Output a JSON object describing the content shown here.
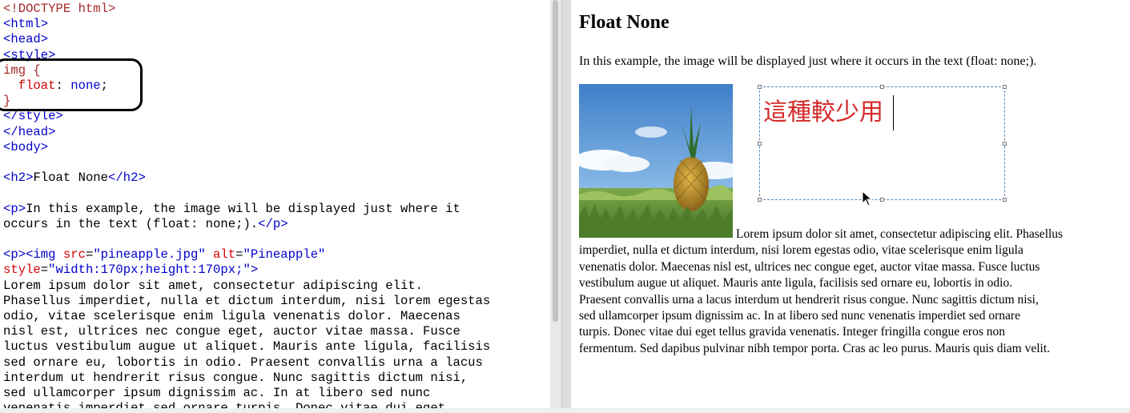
{
  "editor": {
    "lines": [
      [
        {
          "c": "t",
          "s": "<!DOCTYPE html>"
        }
      ],
      [
        {
          "c": "tg",
          "s": "<html>"
        }
      ],
      [
        {
          "c": "tg",
          "s": "<head>"
        }
      ],
      [
        {
          "c": "tg",
          "s": "<style>"
        }
      ],
      [
        {
          "c": "sel",
          "s": "img {"
        }
      ],
      [
        {
          "c": "",
          "s": "  "
        },
        {
          "c": "pr",
          "s": "float"
        },
        {
          "c": "",
          "s": ": "
        },
        {
          "c": "pv",
          "s": "none"
        },
        {
          "c": "",
          "s": ";"
        }
      ],
      [
        {
          "c": "sel",
          "s": "}"
        }
      ],
      [
        {
          "c": "tg",
          "s": "</style>"
        }
      ],
      [
        {
          "c": "tg",
          "s": "</head>"
        }
      ],
      [
        {
          "c": "tg",
          "s": "<body>"
        }
      ],
      [],
      [
        {
          "c": "tg",
          "s": "<h2>"
        },
        {
          "c": "",
          "s": "Float None"
        },
        {
          "c": "tg",
          "s": "</h2>"
        }
      ],
      [],
      [
        {
          "c": "tg",
          "s": "<p>"
        },
        {
          "c": "",
          "s": "In this example, the image will be displayed just where it"
        }
      ],
      [
        {
          "c": "",
          "s": "occurs in the text (float: none;)."
        },
        {
          "c": "tg",
          "s": "</p>"
        }
      ],
      [],
      [
        {
          "c": "tg",
          "s": "<p><img "
        },
        {
          "c": "an",
          "s": "src"
        },
        {
          "c": "",
          "s": "="
        },
        {
          "c": "av",
          "s": "\"pineapple.jpg\""
        },
        {
          "c": "",
          "s": " "
        },
        {
          "c": "an",
          "s": "alt"
        },
        {
          "c": "",
          "s": "="
        },
        {
          "c": "av",
          "s": "\"Pineapple\""
        }
      ],
      [
        {
          "c": "an",
          "s": "style"
        },
        {
          "c": "",
          "s": "="
        },
        {
          "c": "av",
          "s": "\"width:170px;height:170px;\""
        },
        {
          "c": "tg",
          "s": ">"
        }
      ],
      [
        {
          "c": "",
          "s": "Lorem ipsum dolor sit amet, consectetur adipiscing elit."
        }
      ],
      [
        {
          "c": "",
          "s": "Phasellus imperdiet, nulla et dictum interdum, nisi lorem egestas"
        }
      ],
      [
        {
          "c": "",
          "s": "odio, vitae scelerisque enim ligula venenatis dolor. Maecenas"
        }
      ],
      [
        {
          "c": "",
          "s": "nisl est, ultrices nec congue eget, auctor vitae massa. Fusce"
        }
      ],
      [
        {
          "c": "",
          "s": "luctus vestibulum augue ut aliquet. Mauris ante ligula, facilisis"
        }
      ],
      [
        {
          "c": "",
          "s": "sed ornare eu, lobortis in odio. Praesent convallis urna a lacus"
        }
      ],
      [
        {
          "c": "",
          "s": "interdum ut hendrerit risus congue. Nunc sagittis dictum nisi,"
        }
      ],
      [
        {
          "c": "",
          "s": "sed ullamcorper ipsum dignissim ac. In at libero sed nunc"
        }
      ],
      [
        {
          "c": "",
          "s": "venenatis imperdiet sed ornare turpis. Donec vitae dui eget"
        }
      ]
    ]
  },
  "preview": {
    "heading": "Float None",
    "intro": "In this example, the image will be displayed just where it occurs in the text (float: none;).",
    "para_lines": [
      "Lorem ipsum dolor sit amet, consectetur adipiscing elit. Phasellus",
      "imperdiet, nulla et dictum interdum, nisi lorem egestas odio, vitae scelerisque enim ligula",
      "venenatis dolor. Maecenas nisl est, ultrices nec congue eget, auctor vitae massa. Fusce luctus",
      "vestibulum augue ut aliquet. Mauris ante ligula, facilisis sed ornare eu, lobortis in odio.",
      "Praesent convallis urna a lacus interdum ut hendrerit risus congue. Nunc sagittis dictum nisi,",
      "sed ullamcorper ipsum dignissim ac. In at libero sed nunc venenatis imperdiet sed ornare",
      "turpis. Donec vitae dui eget tellus gravida venenatis. Integer fringilla congue eros non",
      "fermentum. Sed dapibus pulvinar nibh tempor porta. Cras ac leo purus. Mauris quis diam velit."
    ],
    "image_alt": "Pineapple"
  },
  "annotation": {
    "text": "這種較少用",
    "color": "#d42a2a",
    "circle_color": "#000000"
  },
  "colors": {
    "tag": "#0000cd",
    "attr_name": "#d00000",
    "property": "#d00000",
    "selector": "#a52a2a"
  }
}
